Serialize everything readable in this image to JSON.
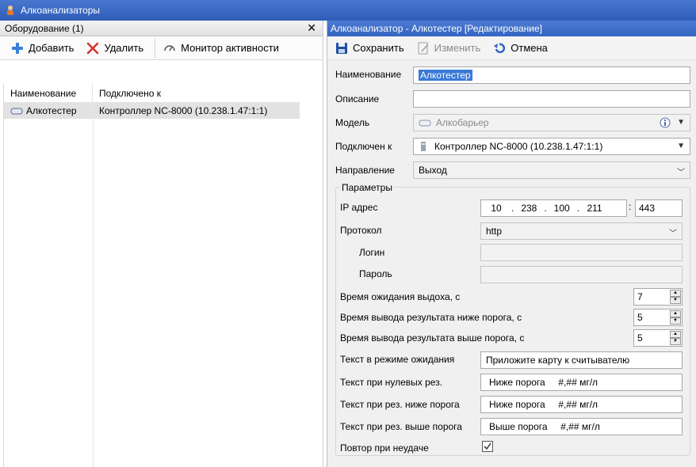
{
  "window": {
    "title": "Алкоанализаторы"
  },
  "left": {
    "header": "Оборудование (1)",
    "close_label": "✕",
    "toolbar": {
      "add": "Добавить",
      "delete": "Удалить",
      "monitor": "Монитор активности"
    },
    "columns": [
      "Наименование",
      "Подключено к"
    ],
    "rows": [
      {
        "name": "Алкотестер",
        "connected": "Контроллер NC-8000 (10.238.1.47:1:1)"
      }
    ]
  },
  "right": {
    "header": "Алкоанализатор - Алкотестер [Редактирование]",
    "toolbar": {
      "save": "Сохранить",
      "edit": "Изменить",
      "cancel": "Отмена"
    },
    "fields": {
      "name_label": "Наименование",
      "name_value": "Алкотестер",
      "desc_label": "Описание",
      "desc_value": "",
      "model_label": "Модель",
      "model_value": "Алкобарьер",
      "conn_label": "Подключен к",
      "conn_value": "Контроллер NC-8000 (10.238.1.47:1:1)",
      "dir_label": "Направление",
      "dir_value": "Выход"
    },
    "params": {
      "group_title": "Параметры",
      "ip_label": "IP адрес",
      "ip": [
        "10",
        "238",
        "100",
        "211"
      ],
      "port": "443",
      "protocol_label": "Протокол",
      "protocol_value": "http",
      "login_label": "Логин",
      "password_label": "Пароль",
      "wait_label": "Время ожидания выдоха, с",
      "wait_value": "7",
      "below_label": "Время вывода результата ниже порога, с",
      "below_value": "5",
      "above_label": "Время вывода результата выше порога, с",
      "above_value": "5",
      "idle_text_label": "Текст в режиме ожидания",
      "idle_text_value": "Приложите карту  к считывателю",
      "zero_text_label": "Текст при нулевых рез.",
      "zero_text_value": "Ниже порога     #,## мг/л",
      "low_text_label": "Текст при рез. ниже порога",
      "low_text_value": "Ниже порога     #,## мг/л",
      "high_text_label": "Текст при рез. выше порога",
      "high_text_value": "Выше порога     #,## мг/л",
      "retry_label": "Повтор при неудаче",
      "retry_checked": true
    }
  },
  "colors": {
    "title_blue": "#3465c2",
    "selection": "#3a79d6",
    "add_icon": "#3b7fd9",
    "delete_icon": "#d9302c"
  }
}
